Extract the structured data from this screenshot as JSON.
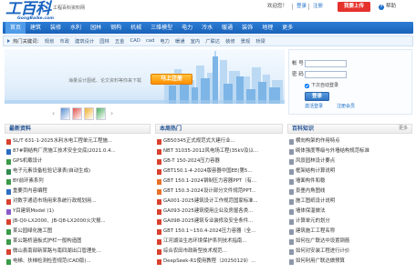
{
  "site": {
    "logo_text": "工百科",
    "logo_tagline": "工程百科资料网",
    "logo_domain": "GongBaike.com"
  },
  "colors": {
    "brand_blue": "#1d6ec9",
    "upload_red": "#e5322d",
    "cta_orange": "#ff9c00"
  },
  "top_links": {
    "welcome": "欢迎您！",
    "login": "登录",
    "register": "注册",
    "upload": "我要上传",
    "help_icon": "help-icon",
    "help": "帮助"
  },
  "nav": {
    "items": [
      "首页",
      "建筑",
      "装修",
      "水利",
      "园林",
      "钢构",
      "机械",
      "三维模型",
      "电力",
      "冷水",
      "暖通",
      "装饰",
      "地理",
      "更多"
    ],
    "active": "首页"
  },
  "hot_keywords": {
    "label": "热门关键词：",
    "items": [
      "规划",
      "市政",
      "建筑设计",
      "园林",
      "五金",
      "CAD",
      "cad",
      "电力",
      "暖通",
      "室内",
      "广联达",
      "装修",
      "景观",
      "桥梁"
    ]
  },
  "banner": {
    "slogan": "海量设计图纸、论文资料等你来下载",
    "cta": "马上注册"
  },
  "login": {
    "account_label": "帐 号",
    "password_label": "密 码",
    "account_value": "",
    "password_value": "",
    "remember_label": "下次自动登录",
    "remember_checked": true,
    "submit": "登录",
    "activate": "激活登录",
    "register": "注册会员"
  },
  "carousel": {
    "prev_icon": "chevron-left-icon",
    "next_icon": "chevron-right-icon",
    "items": [
      "cad-drawing-thumb",
      "3d-model-thumb",
      "pdf-doc-thumb",
      "landscape-thumb"
    ]
  },
  "columns": [
    {
      "title": "最新资料",
      "items": [
        {
          "title": "SL/T 631-1-2025水利水电工程单元工程施...",
          "icon": "pdf-icon"
        },
        {
          "title": "87#钢结构厂房施工技术安全交底(2021.0.4...",
          "icon": "doc-icon"
        },
        {
          "title": "GPS机载设计",
          "icon": "dwg-icon"
        },
        {
          "title": "电子元素设备检验记录表(自动生成)",
          "icon": "xls-icon"
        },
        {
          "title": "BY前环素系列",
          "icon": "dwg-icon"
        },
        {
          "title": "重要页内容编程",
          "icon": "doc-icon"
        },
        {
          "title": "对数字通道市场用来系统行政规划用...",
          "icon": "pdf-icon"
        },
        {
          "title": "Y目建筑Model (1)",
          "icon": "model-icon"
        },
        {
          "title": "JB-Q0-LX2000、JB-Q8-LX2000火灾报...",
          "icon": "pdf-icon"
        },
        {
          "title": "某公园绿化施工图",
          "icon": "dwg-icon"
        },
        {
          "title": "某公路桥涵板式护栏一般构造图",
          "icon": "dwg-icon"
        },
        {
          "title": "微山县南部新某路与南四湖出口管理处...",
          "icon": "pdf-icon"
        },
        {
          "title": "电梯、扶梯检测检查规范(CAD版)...",
          "icon": "dwg-icon"
        }
      ]
    },
    {
      "title": "本周热门",
      "items": [
        {
          "title": "GB50345正式规范式大建行业...",
          "icon": "pdf-icon"
        },
        {
          "title": "NBT 31035-2012风电场工程(35kV及以...",
          "icon": "pdf-icon"
        },
        {
          "title": "GB-T 150-2024压力容器",
          "icon": "pdf-icon"
        },
        {
          "title": "GBT150.1-4-2024版容器中国EE(第5...",
          "icon": "pdf-icon"
        },
        {
          "title": "GBT 150.1-2024钢制压力容器PPT（有...",
          "icon": "ppt-icon"
        },
        {
          "title": "GBT 150.3-2024设计部分文件规范PPT...",
          "icon": "ppt-icon"
        },
        {
          "title": "GA001-2025建筑设计工作规范国家标准...",
          "icon": "pdf-icon"
        },
        {
          "title": "GA093-2025建筑使用企业及房屋各类...",
          "icon": "pdf-icon"
        },
        {
          "title": "GA098-2025建筑专业装修及安全条件...",
          "icon": "pdf-icon"
        },
        {
          "title": "GBT 150.1~150.4-2024压力容器（全...",
          "icon": "pdf-icon"
        },
        {
          "title": "江河湖泊生态环境保护系列技术指南...",
          "icon": "pdf-icon"
        },
        {
          "title": "综合农田市政新型技术规范...",
          "icon": "pdf-icon"
        },
        {
          "title": "DeepSeek-R1使用教程（20250129）...",
          "icon": "pdf-icon"
        }
      ]
    },
    {
      "title": "百科知识",
      "more": "更多",
      "items": [
        {
          "title": "横向构架的作用特点",
          "icon": "article-icon"
        },
        {
          "title": "砌体强度等级与外墙结构规范标准",
          "icon": "article-icon"
        },
        {
          "title": "风景园林设计要点",
          "icon": "article-icon"
        },
        {
          "title": "框架结构计算说明",
          "icon": "article-icon"
        },
        {
          "title": "墙面构件和稳",
          "icon": "article-icon"
        },
        {
          "title": "景墨内角图线",
          "icon": "article-icon"
        },
        {
          "title": "施工图纸设计说明",
          "icon": "article-icon"
        },
        {
          "title": "墙体保温做法",
          "icon": "article-icon"
        },
        {
          "title": "计算单元的划分",
          "icon": "article-icon"
        },
        {
          "title": "建筑施工工程名称",
          "icon": "article-icon"
        },
        {
          "title": "如何在广联达中设置钢筋",
          "icon": "article-icon"
        },
        {
          "title": "如何对安装工程进行计价",
          "icon": "article-icon"
        },
        {
          "title": "如何利用广联达做预算",
          "icon": "article-icon"
        }
      ]
    }
  ]
}
